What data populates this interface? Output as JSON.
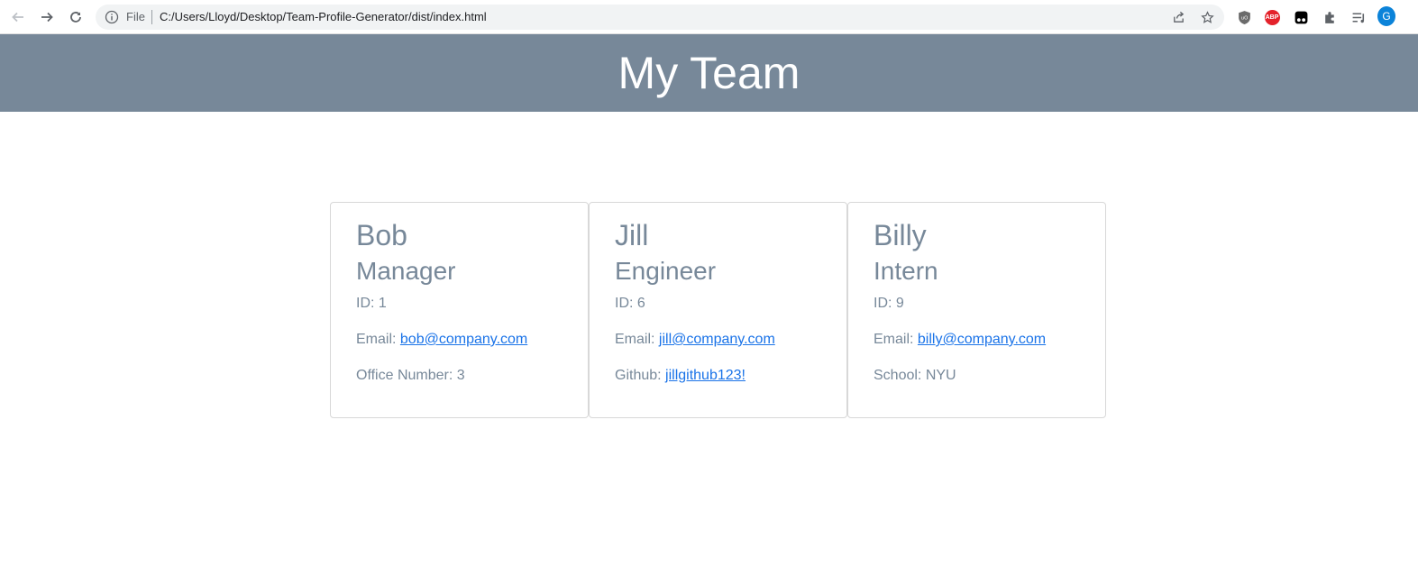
{
  "browser": {
    "file_label": "File",
    "url": "C:/Users/Lloyd/Desktop/Team-Profile-Generator/dist/index.html",
    "profile_initial": "G",
    "abp_label": "ABP"
  },
  "page": {
    "title": "My Team",
    "accent_color": "#778899",
    "link_color": "#1a73e8"
  },
  "cards": [
    {
      "name": "Bob",
      "role": "Manager",
      "id_label": "ID: 1",
      "email_label": "Email: ",
      "email": "bob@company.com",
      "extra_label": "Office Number: 3",
      "extra_link": ""
    },
    {
      "name": "Jill",
      "role": "Engineer",
      "id_label": "ID: 6",
      "email_label": "Email: ",
      "email": "jill@company.com",
      "extra_label": "Github: ",
      "extra_link": "jillgithub123!"
    },
    {
      "name": "Billy",
      "role": "Intern",
      "id_label": "ID: 9",
      "email_label": "Email: ",
      "email": "billy@company.com",
      "extra_label": "School: NYU",
      "extra_link": ""
    }
  ]
}
